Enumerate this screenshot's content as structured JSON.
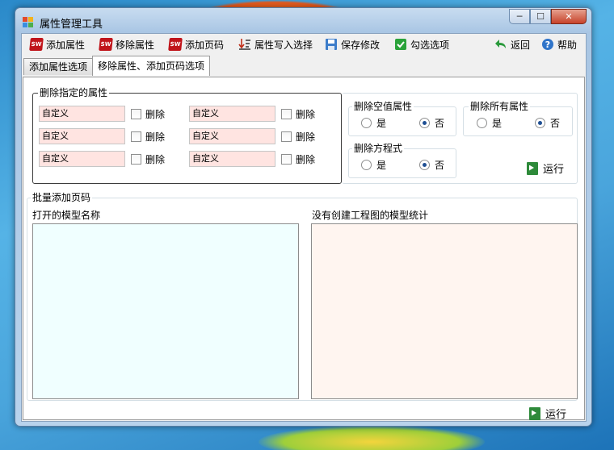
{
  "window": {
    "title": "属性管理工具"
  },
  "window_controls": {
    "minimize": "─",
    "maximize": "☐",
    "close": "✕"
  },
  "toolbar": {
    "add_property": "添加属性",
    "remove_property": "移除属性",
    "add_page_code": "添加页码",
    "write_property_selection": "属性写入选择",
    "save_changes": "保存修改",
    "check_options": "勾选选项",
    "back": "返回",
    "help": "帮助",
    "sw_icon_text": "SW"
  },
  "tabs": [
    {
      "label": "添加属性选项",
      "active": false
    },
    {
      "label": "移除属性、添加页码选项",
      "active": true
    }
  ],
  "delete_specified": {
    "title": "删除指定的属性",
    "fields": [
      {
        "value": "自定义",
        "checkbox_label": "删除",
        "checked": false
      },
      {
        "value": "自定义",
        "checkbox_label": "删除",
        "checked": false
      },
      {
        "value": "自定义",
        "checkbox_label": "删除",
        "checked": false
      },
      {
        "value": "自定义",
        "checkbox_label": "删除",
        "checked": false
      },
      {
        "value": "自定义",
        "checkbox_label": "删除",
        "checked": false
      },
      {
        "value": "自定义",
        "checkbox_label": "删除",
        "checked": false
      }
    ]
  },
  "delete_empty": {
    "title": "删除空值属性",
    "yes": "是",
    "no": "否",
    "selected": "no"
  },
  "delete_all": {
    "title": "删除所有属性",
    "yes": "是",
    "no": "否",
    "selected": "no"
  },
  "delete_equations": {
    "title": "删除方程式",
    "yes": "是",
    "no": "否",
    "selected": "no"
  },
  "run_top": {
    "label": "运行"
  },
  "batch_page": {
    "title": "批量添加页码",
    "open_models_label": "打开的模型名称",
    "no_drawing_label": "没有创建工程图的模型统计"
  },
  "run_bottom": {
    "label": "运行"
  },
  "colors": {
    "field_bg": "#ffe4e1",
    "list_left_bg": "#f0ffff",
    "list_right_bg": "#fff5f0",
    "radio_dot": "#1f4f93",
    "run_icon": "#2e8a3a"
  }
}
